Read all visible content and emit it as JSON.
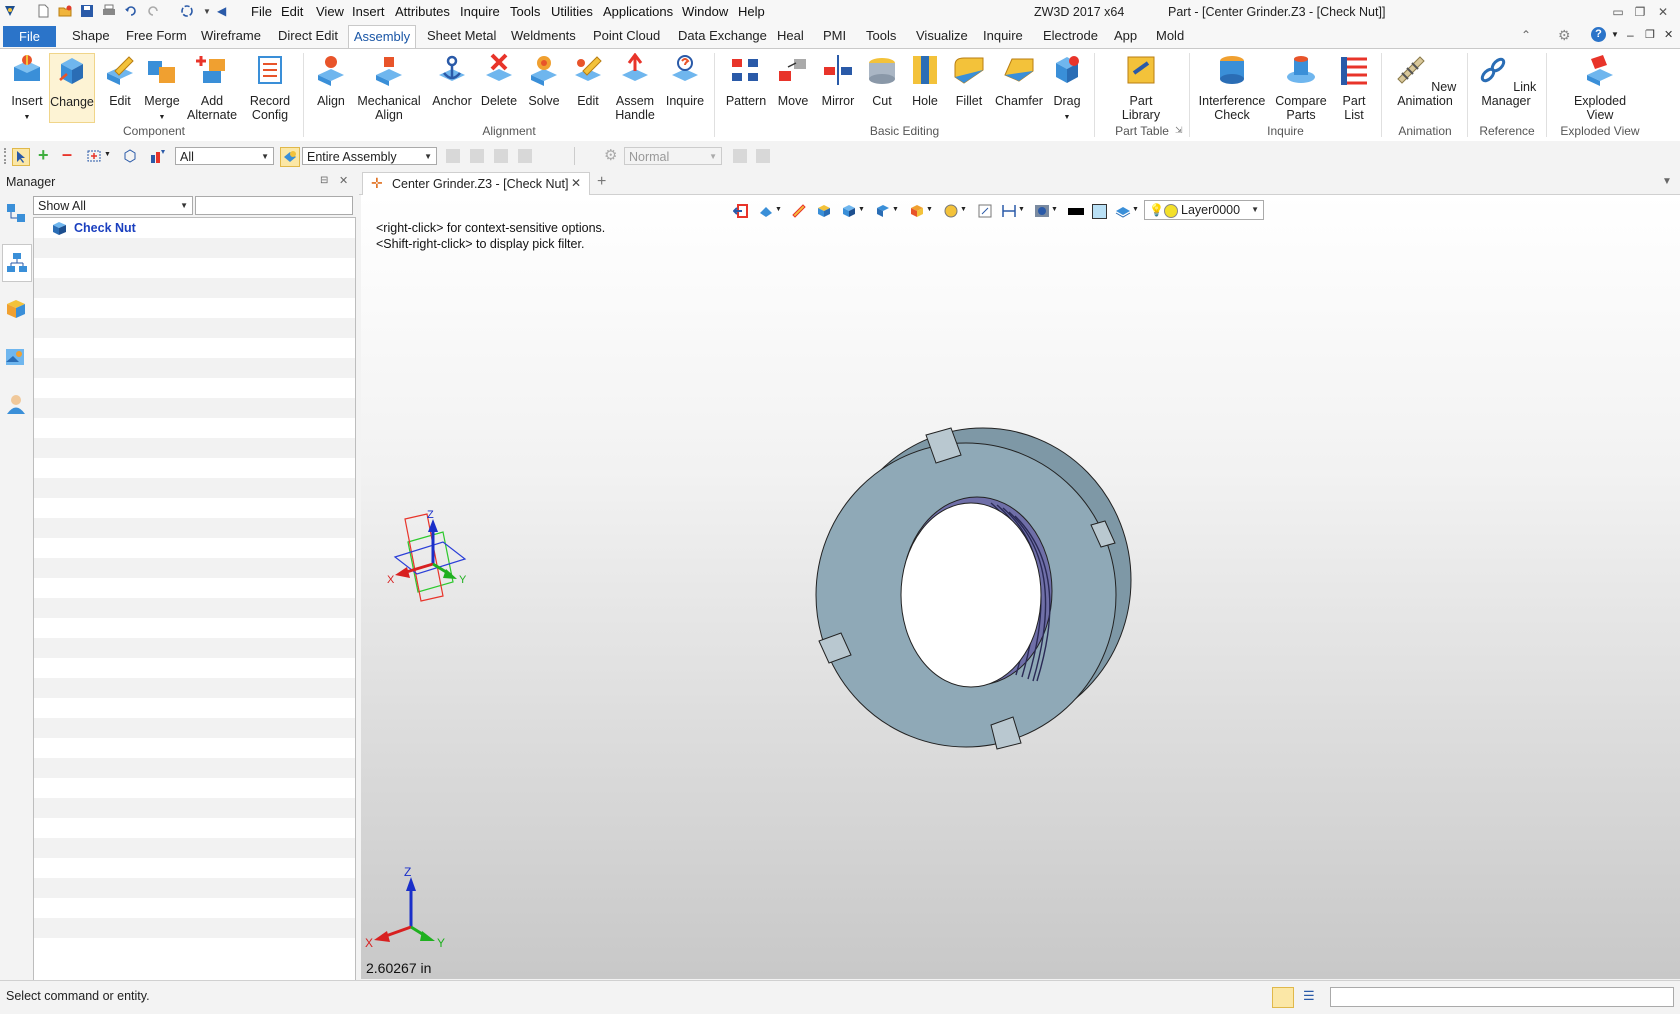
{
  "window": {
    "app_title": "ZW3D 2017  x64",
    "part_title": "Part - [Center Grinder.Z3 - [Check Nut]]"
  },
  "menu": [
    "File",
    "Edit",
    "View",
    "Insert",
    "Attributes",
    "Inquire",
    "Tools",
    "Utilities",
    "Applications",
    "Window",
    "Help"
  ],
  "ribbon_tabs": [
    "File",
    "Shape",
    "Free Form",
    "Wireframe",
    "Direct Edit",
    "Assembly",
    "Sheet Metal",
    "Weldments",
    "Point Cloud",
    "Data Exchange",
    "Heal",
    "PMI",
    "Tools",
    "Visualize",
    "Inquire",
    "Electrode",
    "App",
    "Mold"
  ],
  "ribbon": {
    "component": {
      "label": "Component",
      "buttons": [
        "Insert",
        "Change",
        "Edit",
        "Merge",
        "Add Alternate",
        "Record Config"
      ]
    },
    "alignment": {
      "label": "Alignment",
      "buttons": [
        "Align",
        "Mechanical Align",
        "Anchor",
        "Delete",
        "Solve",
        "Edit",
        "Assem Handle",
        "Inquire"
      ]
    },
    "basic_editing": {
      "label": "Basic Editing",
      "buttons": [
        "Pattern",
        "Move",
        "Mirror",
        "Cut",
        "Hole",
        "Fillet",
        "Chamfer",
        "Drag"
      ]
    },
    "part_table": {
      "label": "Part Table",
      "buttons": [
        "Part Library"
      ]
    },
    "inquire": {
      "label": "Inquire",
      "buttons": [
        "Interference Check",
        "Compare Parts",
        "Part List"
      ]
    },
    "animation": {
      "label": "Animation",
      "buttons": [
        "New Animation"
      ]
    },
    "reference": {
      "label": "Reference",
      "buttons": [
        "Link Manager"
      ]
    },
    "exploded_view": {
      "label": "Exploded View",
      "buttons": [
        "Exploded View"
      ]
    }
  },
  "toolbar": {
    "filter_value": "All",
    "scope_value": "Entire Assembly",
    "mode_value": "Normal"
  },
  "manager": {
    "title": "Manager",
    "filter_value": "Show All",
    "tree_root": "Check Nut"
  },
  "document": {
    "tab_label": "Center Grinder.Z3 - [Check Nut]",
    "hint_line1": "<right-click> for context-sensitive options.",
    "hint_line2": "<Shift-right-click> to display pick filter.",
    "layer": "Layer0000",
    "scale": "2.60267 in"
  },
  "axes": {
    "x": "X",
    "y": "Y",
    "z": "Z"
  },
  "status": {
    "prompt": "Select command or entity."
  },
  "colors": {
    "accent": "#2b74c9",
    "part": "#8fa9b7",
    "thread": "#6f6fa8"
  }
}
